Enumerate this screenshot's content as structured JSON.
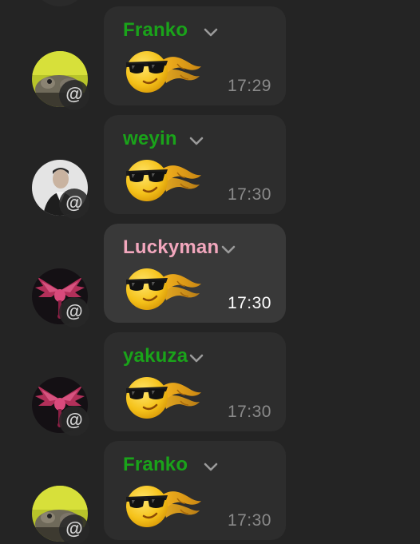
{
  "theme": {
    "background": "#242424",
    "bubble": "#2d2d2d",
    "bubble_highlight": "#393939",
    "sender_green": "#1aa31a",
    "sender_pink": "#f2a7bd",
    "time_color": "#8a8a8a"
  },
  "messages": [
    {
      "sender": "Franko",
      "sender_color": "#1aa31a",
      "time": "17:29",
      "sticker": "cool-sunglasses-face-sticker",
      "avatar_icon": "frog-avatar",
      "mention_badge": "@"
    },
    {
      "sender": "weyin",
      "sender_color": "#1aa31a",
      "time": "17:30",
      "sticker": "cool-sunglasses-face-sticker",
      "avatar_icon": "person-avatar",
      "mention_badge": "@"
    },
    {
      "sender": "Luckyman",
      "sender_color": "#f2a7bd",
      "time": "17:30",
      "sticker": "cool-sunglasses-face-sticker",
      "avatar_icon": "winged-skull-avatar",
      "mention_badge": "@",
      "highlighted": true
    },
    {
      "sender": "yakuza",
      "sender_color": "#1aa31a",
      "time": "17:30",
      "sticker": "cool-sunglasses-face-sticker",
      "avatar_icon": "winged-skull-avatar",
      "mention_badge": "@"
    },
    {
      "sender": "Franko",
      "sender_color": "#1aa31a",
      "time": "17:30",
      "sticker": "cool-sunglasses-face-sticker",
      "avatar_icon": "frog-avatar",
      "mention_badge": "@"
    }
  ]
}
